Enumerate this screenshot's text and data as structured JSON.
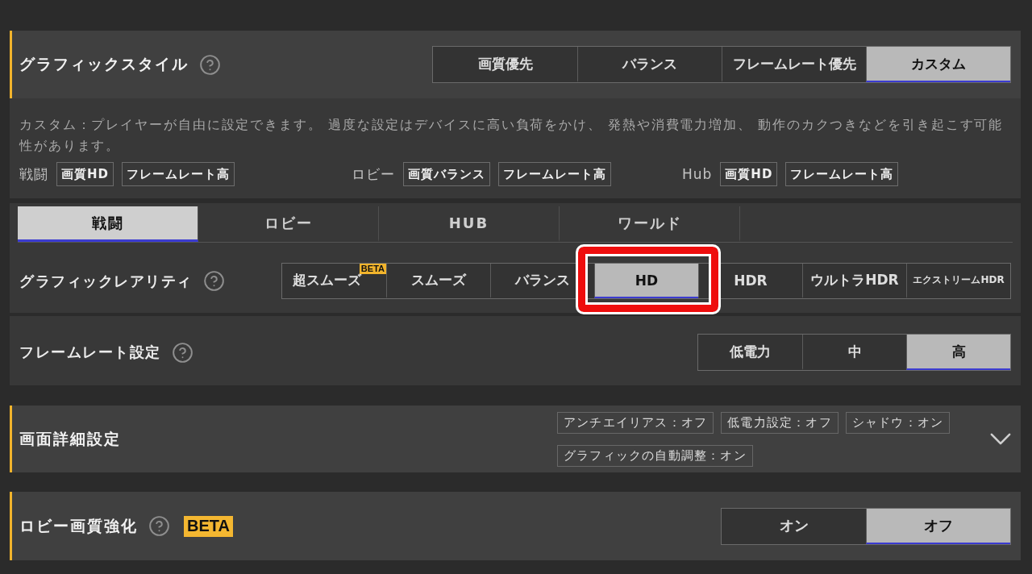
{
  "graphic_style": {
    "title": "グラフィックスタイル",
    "options": [
      {
        "label": "画質優先",
        "selected": false
      },
      {
        "label": "バランス",
        "selected": false
      },
      {
        "label": "フレームレート優先",
        "selected": false
      },
      {
        "label": "カスタム",
        "selected": true
      }
    ],
    "description": "カスタム：プレイヤーが自由に設定できます。 過度な設定はデバイスに高い負荷をかけ、 発熱や消費電力増加、 動作のカクつきなどを引き起こす可能性があります。",
    "presets": [
      {
        "label": "戦闘",
        "tags": [
          "画質HD",
          "フレームレート高"
        ]
      },
      {
        "label": "ロビー",
        "tags": [
          "画質バランス",
          "フレームレート高"
        ]
      },
      {
        "label": "Hub",
        "tags": [
          "画質HD",
          "フレームレート高"
        ]
      }
    ]
  },
  "mode_tabs": [
    {
      "label": "戦闘",
      "selected": true
    },
    {
      "label": "ロビー",
      "selected": false
    },
    {
      "label": "HUB",
      "selected": false
    },
    {
      "label": "ワールド",
      "selected": false
    }
  ],
  "graphic_rarity": {
    "title": "グラフィックレアリティ",
    "options": [
      {
        "label": "超スムーズ",
        "badge": "BETA",
        "selected": false,
        "highlighted": false
      },
      {
        "label": "スムーズ",
        "selected": false,
        "highlighted": false
      },
      {
        "label": "バランス",
        "selected": false,
        "highlighted": false
      },
      {
        "label": "HD",
        "selected": true,
        "highlighted": true
      },
      {
        "label": "HDR",
        "selected": false,
        "highlighted": false
      },
      {
        "label": "ウルトラHDR",
        "selected": false,
        "highlighted": false
      },
      {
        "label": "エクストリームHDR",
        "selected": false,
        "highlighted": false
      }
    ]
  },
  "frame_rate": {
    "title": "フレームレート設定",
    "options": [
      {
        "label": "低電力",
        "selected": false
      },
      {
        "label": "中",
        "selected": false
      },
      {
        "label": "高",
        "selected": true
      }
    ]
  },
  "display_details": {
    "title": "画面詳細設定",
    "tags": [
      "アンチエイリアス：オフ",
      "低電力設定：オフ",
      "シャドウ：オン",
      "グラフィックの自動調整：オン"
    ]
  },
  "lobby_enhancement": {
    "title": "ロビー画質強化",
    "badge": "BETA",
    "options": [
      {
        "label": "オン",
        "selected": false
      },
      {
        "label": "オフ",
        "selected": true
      }
    ]
  }
}
